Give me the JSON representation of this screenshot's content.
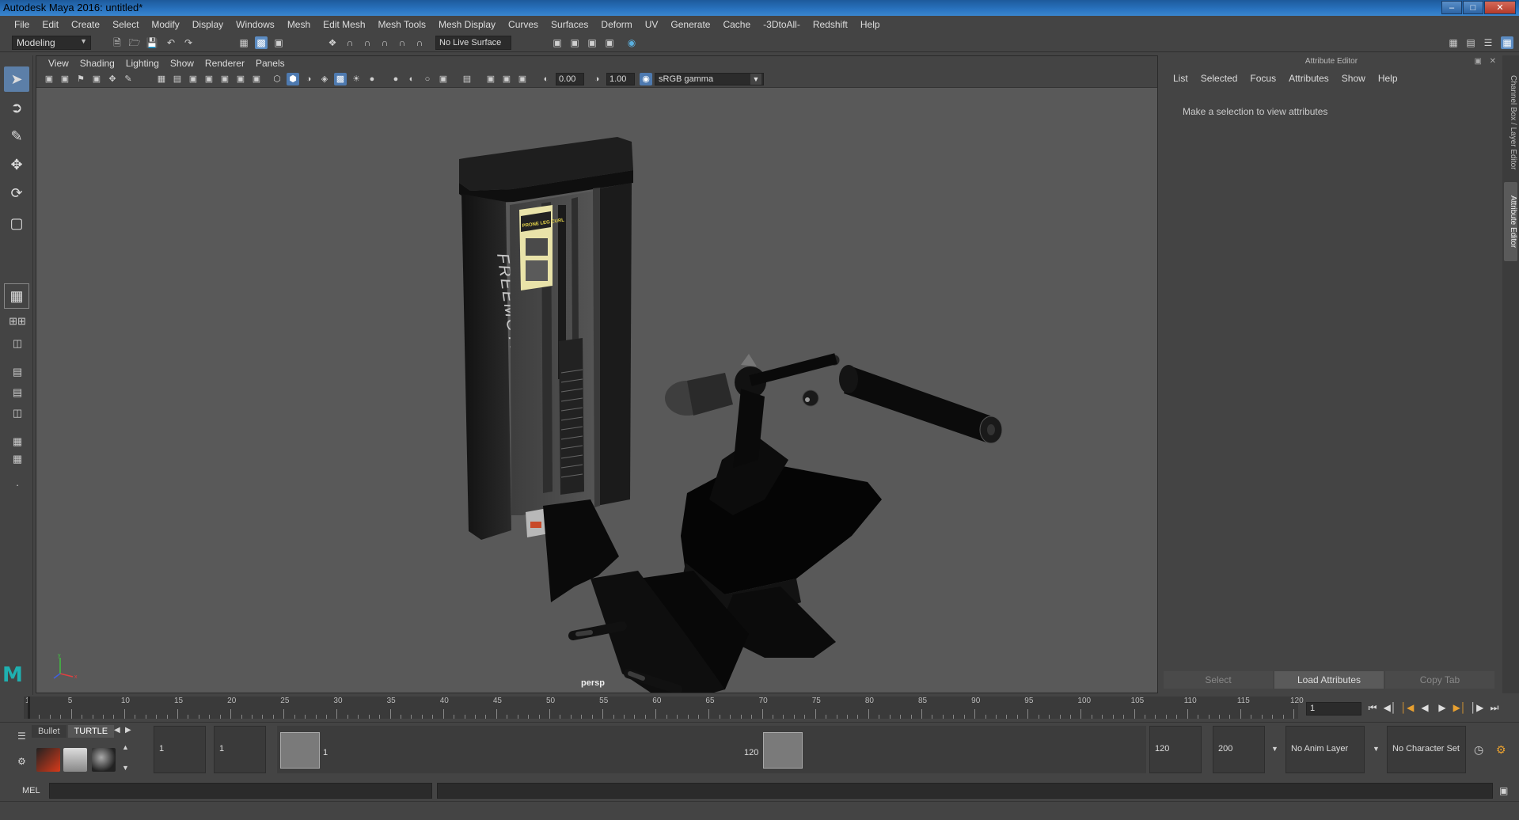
{
  "window": {
    "title": "Autodesk Maya 2016: untitled*"
  },
  "menubar": [
    "File",
    "Edit",
    "Create",
    "Select",
    "Modify",
    "Display",
    "Windows",
    "Mesh",
    "Edit Mesh",
    "Mesh Tools",
    "Mesh Display",
    "Curves",
    "Surfaces",
    "Deform",
    "UV",
    "Generate",
    "Cache",
    "-3DtoAll-",
    "Redshift",
    "Help"
  ],
  "shelf": {
    "mode": "Modeling",
    "live_surface": "No Live Surface"
  },
  "viewport": {
    "menu": [
      "View",
      "Shading",
      "Lighting",
      "Show",
      "Renderer",
      "Panels"
    ],
    "exposure": "0.00",
    "gamma_value": "1.00",
    "color_space": "sRGB gamma",
    "camera": "persp",
    "model_brand": "FREEMOTION",
    "placard_title": "PRONE LEG CURL"
  },
  "attribute_editor": {
    "header": "Attribute Editor",
    "menu": [
      "List",
      "Selected",
      "Focus",
      "Attributes",
      "Show",
      "Help"
    ],
    "message": "Make a selection to view attributes",
    "buttons": {
      "select": "Select",
      "load": "Load Attributes",
      "copy": "Copy Tab"
    }
  },
  "side_tabs": {
    "channel": "Channel Box / Layer Editor",
    "attr": "Attribute Editor"
  },
  "timeline": {
    "ticks": [
      "1",
      "5",
      "10",
      "15",
      "20",
      "25",
      "30",
      "35",
      "40",
      "45",
      "50",
      "55",
      "60",
      "65",
      "70",
      "75",
      "80",
      "85",
      "90",
      "95",
      "100",
      "105",
      "110",
      "115",
      "120"
    ],
    "current_frame": "1"
  },
  "range": {
    "shelf_tabs": [
      "Bullet",
      "TURTLE"
    ],
    "start": "1",
    "playback_start": "1",
    "slider_start": "1",
    "slider_end": "120",
    "playback_end": "120",
    "end": "200",
    "anim_layer": "No Anim Layer",
    "character_set": "No Character Set"
  },
  "cmd": {
    "label": "MEL"
  },
  "colors": {
    "accent": "#5c8cc2",
    "viewport_bg": "#595959",
    "panel_bg": "#444444",
    "maya_logo": "#1fb0b0"
  },
  "icons": [
    "select-icon",
    "lasso-icon",
    "paint-select-icon",
    "move-icon",
    "rotate-icon",
    "scale-icon",
    "play-icon",
    "rewind-icon",
    "forward-icon"
  ]
}
